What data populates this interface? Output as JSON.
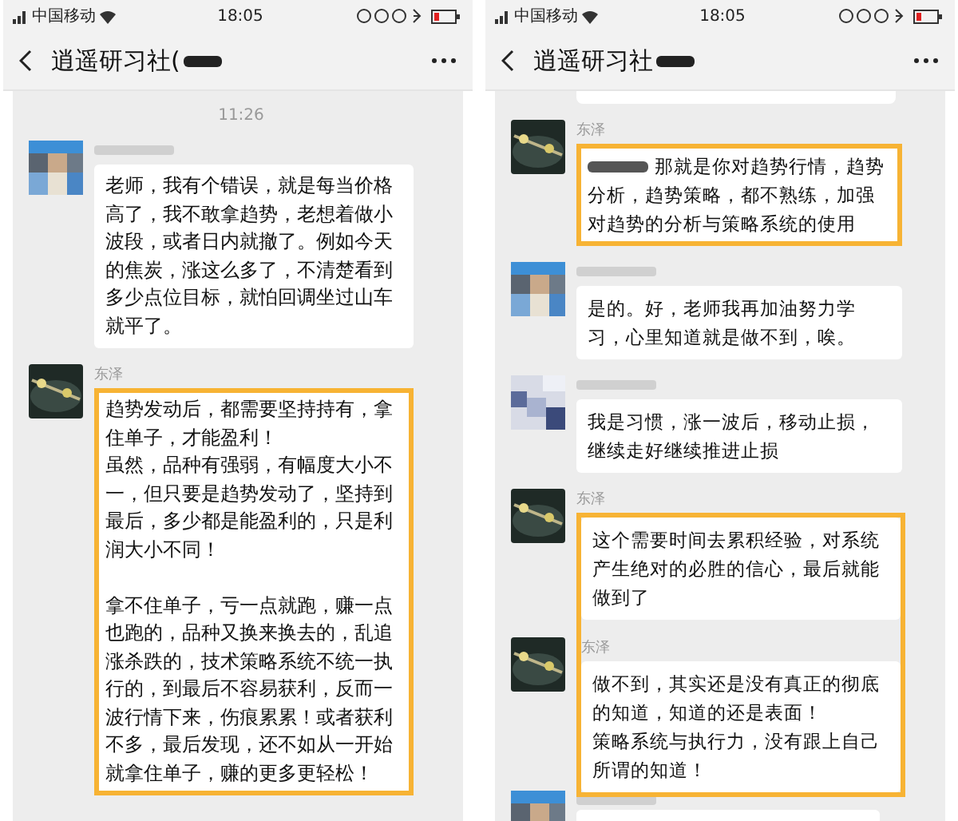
{
  "phones": [
    {
      "status_bar": {
        "carrier": "中国移动",
        "time": "18:05"
      },
      "header": {
        "title": "逍遥研习社("
      },
      "chat": [
        {
          "kind": "time",
          "text": "11:26"
        },
        {
          "kind": "message",
          "avatar": {
            "kind": "mosaic"
          },
          "highlighted": false,
          "paragraphs": [
            {
              "text": "老师，我有个错误，就是每当价格高了，我不敢拿趋势，老想着做小波段，或者日内就撤了。例如今天的焦炭，涨这么多了，不清楚看到多少点位目标，就怕回调坐过山车就平了。"
            }
          ]
        },
        {
          "kind": "message",
          "avatar": {
            "kind": "photo"
          },
          "sender": "东泽",
          "highlighted": true,
          "paragraphs": [
            {
              "text": "趋势发动后，都需要坚持持有，拿住单子，才能盈利！"
            },
            {
              "text": "虽然，品种有强弱，有幅度大小不一，但只要是趋势发动了，坚持到最后，多少都是能盈利的，只是利润大小不同！",
              "space_before": false
            },
            {
              "text": "拿不住单子，亏一点就跑，赚一点也跑的，品种又换来换去的，乱追涨杀跌的，技术策略系统不统一执行的，到最后不容易获利，反而一波行情下来，伤痕累累！或者获利不多，最后发现，还不如从一开始就拿住单子，赚的更多更轻松！",
              "space_before": true
            }
          ]
        }
      ]
    },
    {
      "status_bar": {
        "carrier": "中国移动",
        "time": "18:05"
      },
      "header": {
        "title": "逍遥研习社"
      },
      "chat": [
        {
          "kind": "cut_top"
        },
        {
          "kind": "message",
          "avatar": {
            "kind": "photo"
          },
          "sender": "东泽",
          "highlighted": true,
          "mention_hidden": true,
          "paragraphs": [
            {
              "text": "那就是你对趋势行情，趋势分析，趋势策略，都不熟练，加强对趋势的分析与策略系统的使用"
            }
          ]
        },
        {
          "kind": "message",
          "avatar": {
            "kind": "mosaic"
          },
          "highlighted": false,
          "paragraphs": [
            {
              "text": "是的。好，老师我再加油努力学习，心里知道就是做不到，唉。"
            }
          ]
        },
        {
          "kind": "message",
          "avatar": {
            "kind": "mosaic2"
          },
          "highlighted": false,
          "paragraphs": [
            {
              "text": "我是习惯，涨一波后，移动止损，继续走好继续推进止损"
            }
          ]
        },
        {
          "kind": "highlight_group",
          "messages": [
            {
              "avatar": {
                "kind": "photo"
              },
              "sender": "东泽",
              "paragraphs": [
                {
                  "text": "这个需要时间去累积经验，对系统产生绝对的必胜的信心，最后就能做到了"
                }
              ]
            },
            {
              "avatar": {
                "kind": "photo"
              },
              "sender": "东泽",
              "paragraphs": [
                {
                  "text": "做不到，其实还是没有真正的彻底的知道，知道的还是表面！"
                },
                {
                  "text": "策略系统与执行力，没有跟上自己所谓的知道！",
                  "space_before": false
                }
              ]
            }
          ]
        },
        {
          "kind": "cut_bottom",
          "avatar": {
            "kind": "mosaic"
          }
        }
      ]
    }
  ]
}
